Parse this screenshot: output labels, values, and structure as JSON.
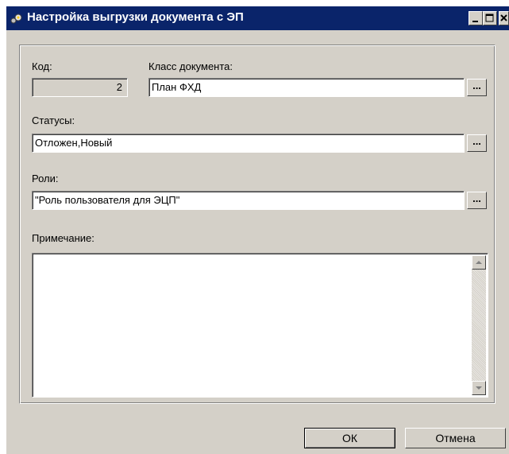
{
  "window": {
    "title": "Настройка выгрузки документа с ЭП"
  },
  "form": {
    "code_label": "Код:",
    "code_value": "2",
    "doc_class_label": "Класс документа:",
    "doc_class_value": "План ФХД",
    "statuses_label": "Статусы:",
    "statuses_value": "Отложен,Новый",
    "roles_label": "Роли:",
    "roles_value": "\"Роль пользователя для ЭЦП\"",
    "note_label": "Примечание:",
    "note_value": "",
    "browse_label": "..."
  },
  "buttons": {
    "ok_label": "ОК",
    "cancel_label": "Отмена"
  },
  "colors": {
    "titlebar": "#0a246a",
    "window_face": "#d4d0c8"
  }
}
